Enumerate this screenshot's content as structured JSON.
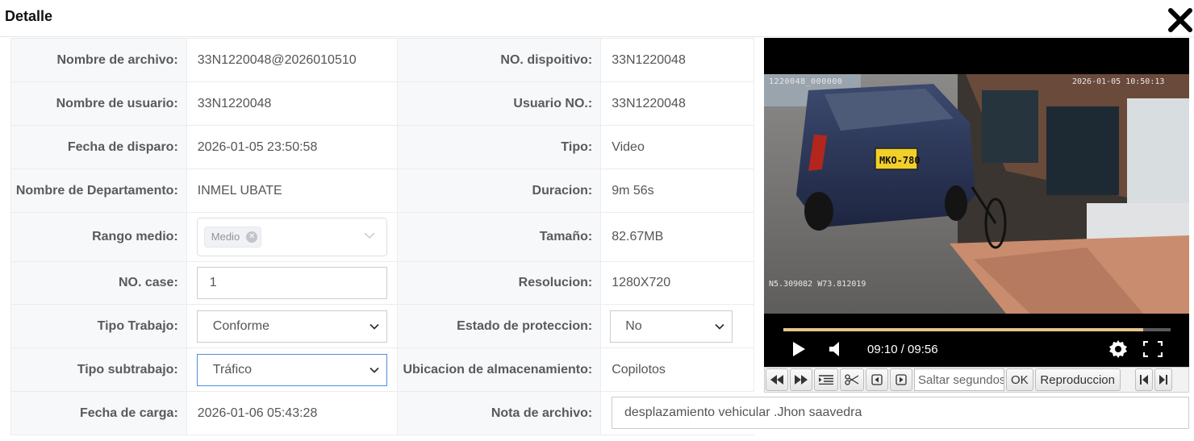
{
  "dialog": {
    "title": "Detalle"
  },
  "fields": {
    "nombre_archivo": {
      "label": "Nombre de archivo:",
      "value": "33N1220048@2026010510"
    },
    "no_dispositivo": {
      "label": "NO. dispoitivo:",
      "value": "33N1220048"
    },
    "nombre_usuario": {
      "label": "Nombre de usuario:",
      "value": "33N1220048"
    },
    "usuario_no": {
      "label": "Usuario NO.:",
      "value": "33N1220048"
    },
    "fecha_disparo": {
      "label": "Fecha de disparo:",
      "value": "2026-01-05 23:50:58"
    },
    "tipo": {
      "label": "Tipo:",
      "value": "Video"
    },
    "departamento": {
      "label": "Nombre de Departamento:",
      "value": "INMEL UBATE"
    },
    "duracion": {
      "label": "Duracion:",
      "value": "9m 56s"
    },
    "rango_medio": {
      "label": "Rango medio:",
      "tag": "Medio"
    },
    "tamano": {
      "label": "Tamaño:",
      "value": "82.67MB"
    },
    "no_case": {
      "label": "NO. case:",
      "value": "1"
    },
    "resolucion": {
      "label": "Resolucion:",
      "value": "1280X720"
    },
    "tipo_trabajo": {
      "label": "Tipo Trabajo:",
      "value": "Conforme"
    },
    "estado_proteccion": {
      "label": "Estado de proteccion:",
      "value": "No"
    },
    "tipo_subtrabajo": {
      "label": "Tipo subtrabajo:",
      "value": "Tráfico"
    },
    "ubicacion": {
      "label": "Ubicacion de almacenamiento:",
      "value": "Copilotos"
    },
    "fecha_carga": {
      "label": "Fecha de carga:",
      "value": "2026-01-06 05:43:28"
    },
    "nota": {
      "label": "Nota de archivo:",
      "value": "desplazamiento vehicular .Jhon saavedra"
    }
  },
  "video": {
    "osd_top_left": "1220048_000000",
    "osd_top_right": "2026-01-05 10:50:13",
    "osd_bottom_left": "N5.309082 W73.812019",
    "plate": "MKO-780",
    "time_display": "09:10 / 09:56",
    "progress": 0.93
  },
  "toolbar": {
    "seek_placeholder": "Saltar segundos",
    "ok_label": "OK",
    "playback_label": "Reproduccion"
  },
  "icons": [
    "close-icon",
    "play-icon",
    "volume-icon",
    "settings-icon",
    "fullscreen-icon",
    "rewind-icon",
    "fast-forward-icon",
    "list-icon",
    "scissors-icon",
    "frame-back-icon",
    "frame-forward-icon",
    "skip-start-icon",
    "skip-end-icon",
    "chevron-down-icon",
    "tag-close-icon"
  ]
}
